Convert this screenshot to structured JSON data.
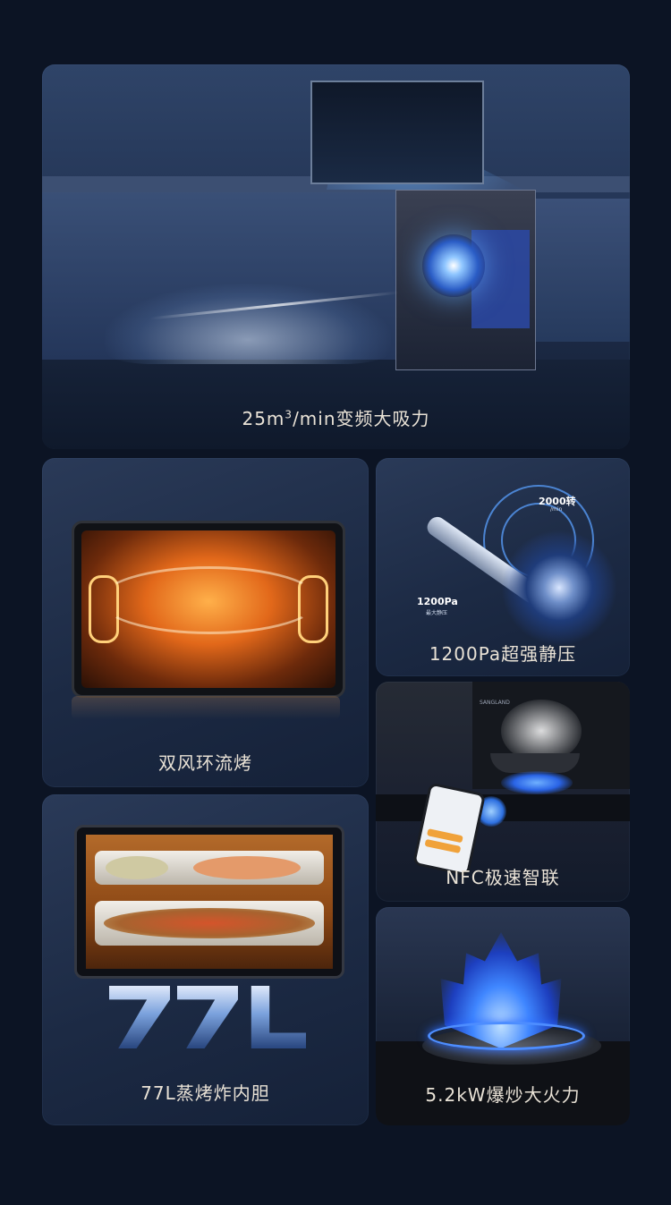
{
  "hero": {
    "caption_pre": "25m",
    "caption_sup": "3",
    "caption_post": "/min变频大吸力"
  },
  "oven_card": {
    "caption": "双风环流烤"
  },
  "fan_card": {
    "caption": "1200Pa超强静压",
    "speed_value": "2000转",
    "speed_unit": "/min",
    "pressure_value": "1200Pa",
    "pressure_sub": "最大静压"
  },
  "nfc_card": {
    "caption": "NFC极速智联",
    "brand_small": "SANGLAND"
  },
  "liter_card": {
    "caption": "77L蒸烤炸内胆",
    "big_text": "77L"
  },
  "flame_card": {
    "caption": "5.2kW爆炒大火力"
  },
  "colors": {
    "background": "#0c1424",
    "card": "#22324f",
    "caption": "#e9e2d6",
    "accent_blue": "#3f86ff",
    "accent_orange": "#e2681a"
  }
}
